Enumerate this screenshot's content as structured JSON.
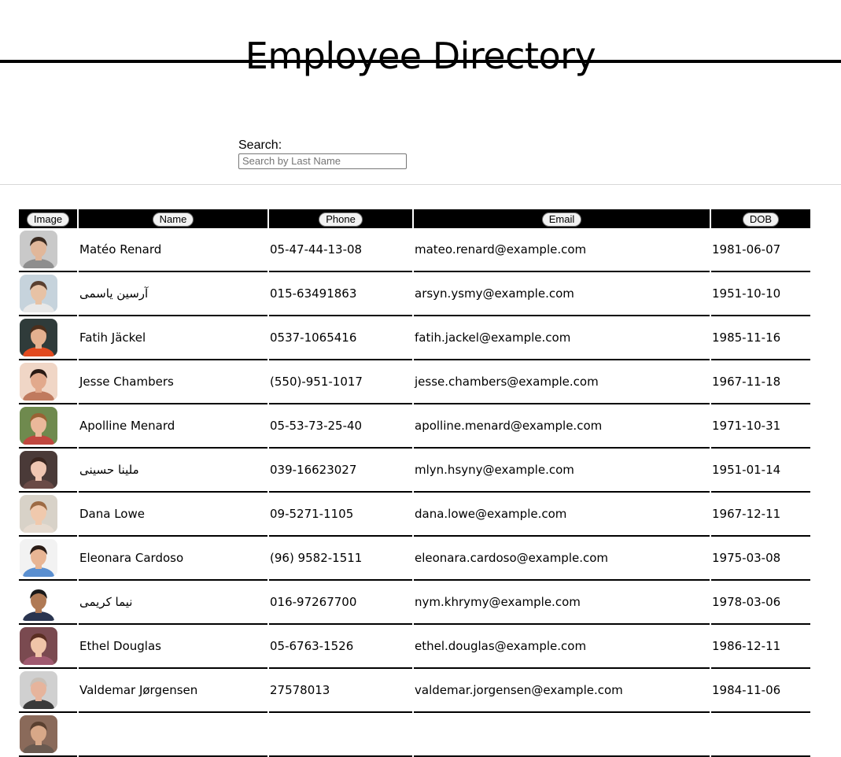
{
  "page": {
    "title": "Employee Directory"
  },
  "search": {
    "label": "Search:",
    "placeholder": "Search by Last Name"
  },
  "table": {
    "columns": [
      "Image",
      "Name",
      "Phone",
      "Email",
      "DOB"
    ],
    "rows": [
      {
        "name": "Matéo Renard",
        "phone": "05-47-44-13-08",
        "email": "mateo.renard@example.com",
        "dob": "1981-06-07",
        "bg": "#c9c9c9",
        "skin": "#e1b79a",
        "hair": "#3a2a20",
        "shirt": "#8e8e8e"
      },
      {
        "name": "آرسین یاسمی",
        "phone": "015-63491863",
        "email": "arsyn.ysmy@example.com",
        "dob": "1951-10-10",
        "bg": "#c6d3dc",
        "skin": "#e7c2a5",
        "hair": "#5a4030",
        "shirt": "#e8e8e8"
      },
      {
        "name": "Fatih Jäckel",
        "phone": "0537-1065416",
        "email": "fatih.jackel@example.com",
        "dob": "1985-11-16",
        "bg": "#2f3b3a",
        "skin": "#e4b08f",
        "hair": "#4b2e1c",
        "shirt": "#e24a1f"
      },
      {
        "name": "Jesse Chambers",
        "phone": "(550)-951-1017",
        "email": "jesse.chambers@example.com",
        "dob": "1967-11-18",
        "bg": "#f0d6c6",
        "skin": "#e2a98c",
        "hair": "#2a1a14",
        "shirt": "#c07a5e"
      },
      {
        "name": "Apolline Menard",
        "phone": "05-53-73-25-40",
        "email": "apolline.menard@example.com",
        "dob": "1971-10-31",
        "bg": "#6f8a4e",
        "skin": "#eab89a",
        "hair": "#9a6234",
        "shirt": "#c0473f"
      },
      {
        "name": "ملینا حسینی",
        "phone": "039-16623027",
        "email": "mlyn.hsyny@example.com",
        "dob": "1951-01-14",
        "bg": "#4a3a38",
        "skin": "#efc6b2",
        "hair": "#3b2620",
        "shirt": "#6a4a46"
      },
      {
        "name": "Dana Lowe",
        "phone": "09-5271-1105",
        "email": "dana.lowe@example.com",
        "dob": "1967-12-11",
        "bg": "#d8d2c8",
        "skin": "#f0c9ad",
        "hair": "#9d6b45",
        "shirt": "#e6dbd0"
      },
      {
        "name": "Eleonara Cardoso",
        "phone": "(96) 9582-1511",
        "email": "eleonara.cardoso@example.com",
        "dob": "1975-03-08",
        "bg": "#f2f2f2",
        "skin": "#e8b594",
        "hair": "#2a1c16",
        "shirt": "#5a8fd0"
      },
      {
        "name": "نیما کریمی",
        "phone": "016-97267700",
        "email": "nym.khrymy@example.com",
        "dob": "1978-03-06",
        "bg": "#ffffff",
        "skin": "#b07a55",
        "hair": "#1a1a1a",
        "shirt": "#2a3550"
      },
      {
        "name": "Ethel Douglas",
        "phone": "05-6763-1526",
        "email": "ethel.douglas@example.com",
        "dob": "1986-12-11",
        "bg": "#7a4a50",
        "skin": "#f0c4a8",
        "hair": "#5a2e22",
        "shirt": "#a05a70"
      },
      {
        "name": "Valdemar Jørgensen",
        "phone": "27578013",
        "email": "valdemar.jorgensen@example.com",
        "dob": "1984-11-06",
        "bg": "#d0d0d0",
        "skin": "#e6b49c",
        "hair": "#c8c0b8",
        "shirt": "#3a3a3a"
      },
      {
        "name": "",
        "phone": "",
        "email": "",
        "dob": "",
        "bg": "#8a6a5a",
        "skin": "#d8a888",
        "hair": "#5a4030",
        "shirt": "#6a5a50"
      }
    ]
  }
}
